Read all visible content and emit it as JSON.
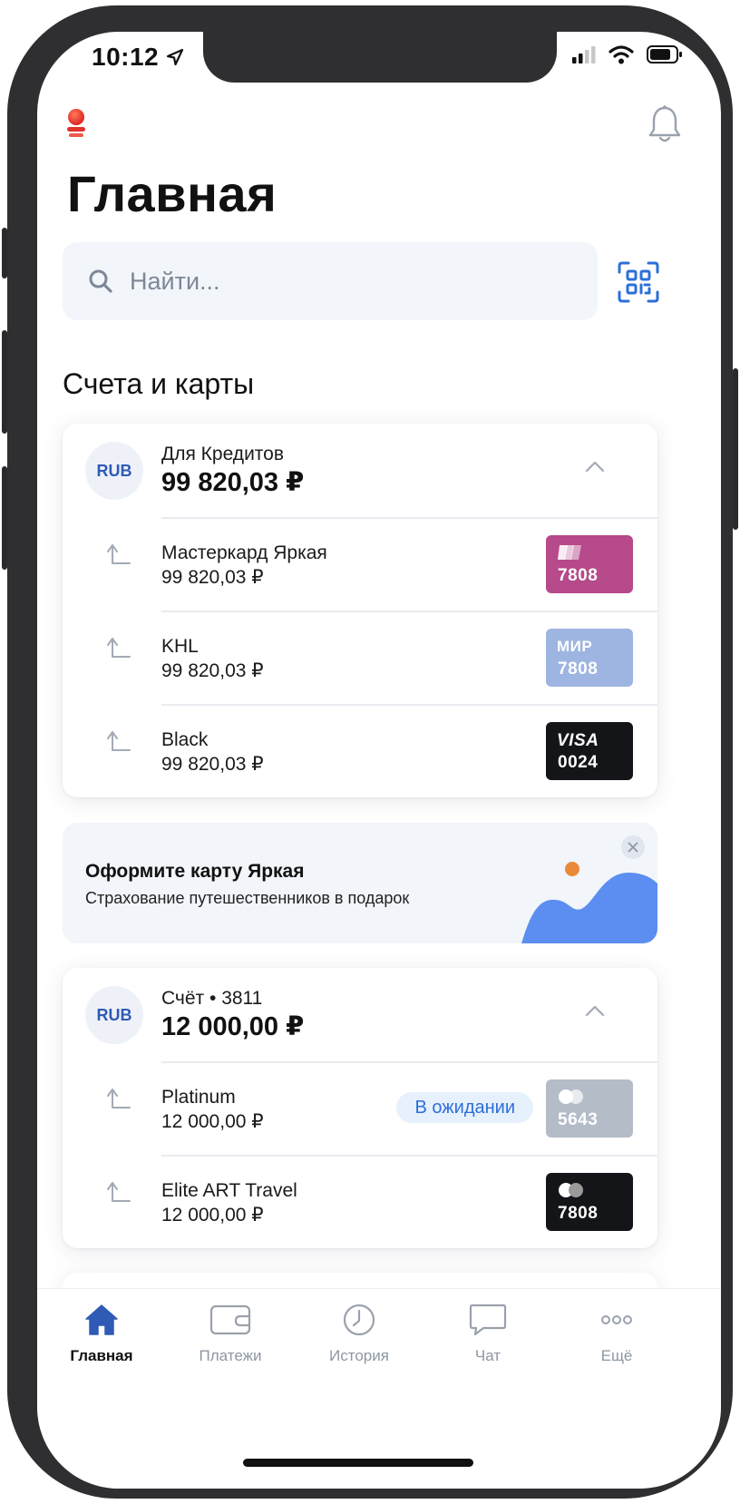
{
  "status_bar": {
    "time": "10:12"
  },
  "header": {
    "title": "Главная"
  },
  "search": {
    "placeholder": "Найти..."
  },
  "section": {
    "title": "Счета и карты"
  },
  "accounts": [
    {
      "currency": "RUB",
      "name": "Для Кредитов",
      "balance": "99 820,03 ₽",
      "cards": [
        {
          "name": "Мастеркард Яркая",
          "balance": "99 820,03 ₽",
          "card_number": "7808",
          "card_color": "#b64a8a",
          "card_logo": ""
        },
        {
          "name": "KHL",
          "balance": "99 820,03 ₽",
          "card_number": "7808",
          "card_color": "#9db5e0",
          "card_logo": "МИР"
        },
        {
          "name": "Black",
          "balance": "99 820,03 ₽",
          "card_number": "0024",
          "card_color": "#141518",
          "card_logo": "VISA"
        }
      ]
    },
    {
      "currency": "RUB",
      "name": "Счёт • 3811",
      "balance": "12 000,00 ₽",
      "cards": [
        {
          "name": "Platinum",
          "balance": "12 000,00 ₽",
          "card_number": "5643",
          "card_color": "#b4bcc8",
          "status": "В ожидании"
        },
        {
          "name": "Elite ART Travel",
          "balance": "12 000,00 ₽",
          "card_number": "7808",
          "card_color": "#141518"
        }
      ]
    }
  ],
  "promo": {
    "title": "Оформите карту Яркая",
    "subtitle": "Страхование путешественников в подарок"
  },
  "tabbar": [
    {
      "label": "Главная",
      "icon": "home-icon",
      "active": true
    },
    {
      "label": "Платежи",
      "icon": "wallet-icon",
      "active": false
    },
    {
      "label": "История",
      "icon": "clock-icon",
      "active": false
    },
    {
      "label": "Чат",
      "icon": "chat-icon",
      "active": false
    },
    {
      "label": "Ещё",
      "icon": "more-icon",
      "active": false
    }
  ],
  "colors": {
    "accent": "#2f5bb5",
    "link_blue": "#2c6fd8",
    "surface": "#f2f5fa",
    "frame": "#2f2f31"
  }
}
